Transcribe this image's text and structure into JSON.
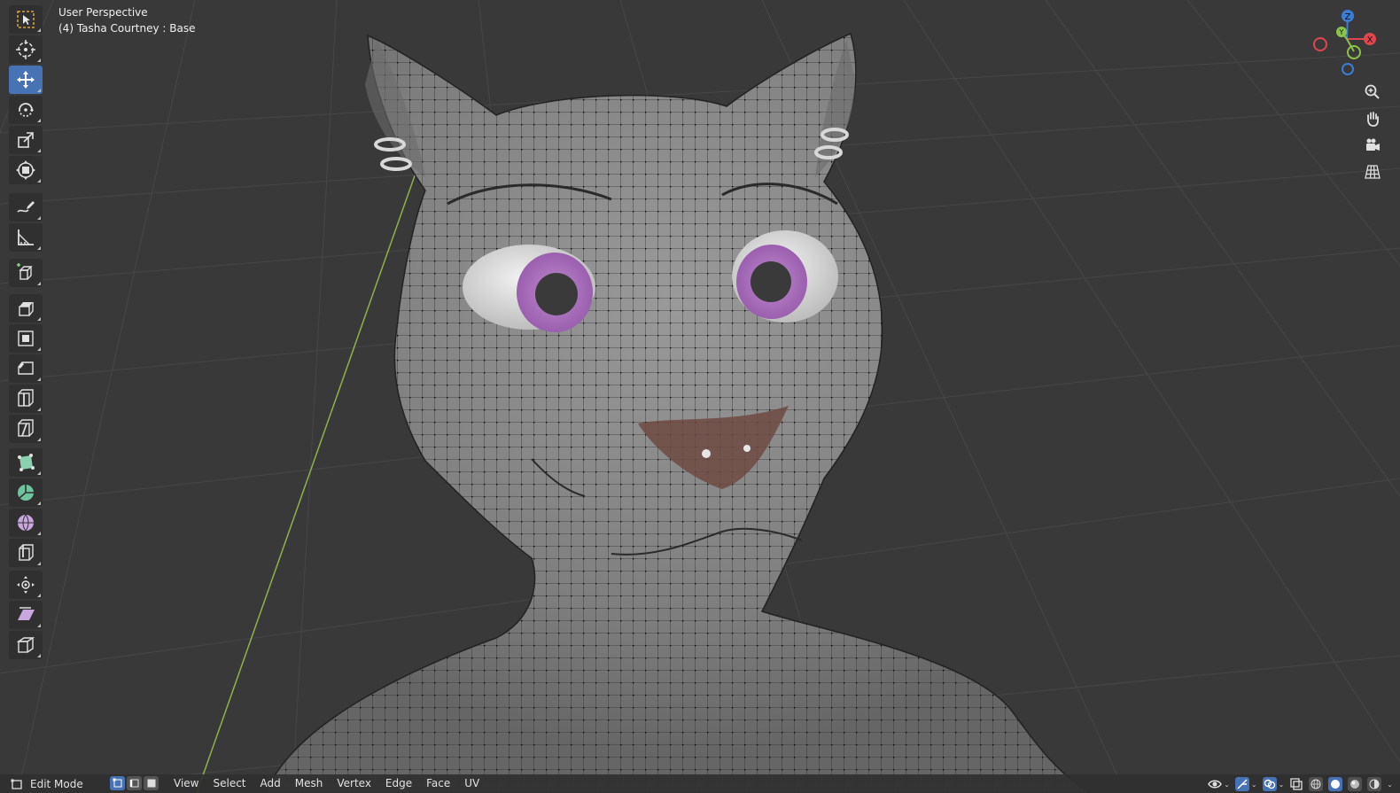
{
  "viewport": {
    "view_name": "User Perspective",
    "object_info": "(4) Tasha Courtney : Base"
  },
  "toolbar": {
    "tools": [
      {
        "name": "select-box-tool",
        "icon": "select-box-icon",
        "active": false
      },
      {
        "name": "cursor-tool",
        "icon": "cursor-icon",
        "active": false
      },
      {
        "name": "move-tool",
        "icon": "move-icon",
        "active": true
      },
      {
        "name": "rotate-tool",
        "icon": "rotate-icon",
        "active": false
      },
      {
        "name": "scale-tool",
        "icon": "scale-icon",
        "active": false
      },
      {
        "name": "transform-tool",
        "icon": "transform-icon",
        "active": false
      },
      {
        "name": "annotate-tool",
        "icon": "annotate-icon",
        "active": false
      },
      {
        "name": "measure-tool",
        "icon": "measure-icon",
        "active": false
      },
      {
        "name": "add-cube-tool",
        "icon": "add-cube-icon",
        "active": false
      },
      {
        "name": "extrude-tool",
        "icon": "extrude-icon",
        "active": false
      },
      {
        "name": "inset-faces-tool",
        "icon": "inset-icon",
        "active": false
      },
      {
        "name": "bevel-tool",
        "icon": "bevel-icon",
        "active": false
      },
      {
        "name": "loop-cut-tool",
        "icon": "loop-cut-icon",
        "active": false
      },
      {
        "name": "knife-tool",
        "icon": "knife-icon",
        "active": false
      },
      {
        "name": "poly-build-tool",
        "icon": "poly-build-icon",
        "active": false
      },
      {
        "name": "spin-tool",
        "icon": "spin-icon",
        "active": false
      },
      {
        "name": "smooth-tool",
        "icon": "smooth-icon",
        "active": false
      },
      {
        "name": "edge-slide-tool",
        "icon": "edge-slide-icon",
        "active": false
      },
      {
        "name": "shrink-fatten-tool",
        "icon": "shrink-fatten-icon",
        "active": false
      },
      {
        "name": "shear-tool",
        "icon": "shear-icon",
        "active": false
      },
      {
        "name": "rip-region-tool",
        "icon": "rip-icon",
        "active": false
      }
    ]
  },
  "gizmo": {
    "z_label": "Z",
    "y_label": "Y",
    "x_label": "X",
    "colors": {
      "x": "#e1464f",
      "y": "#8bc34a",
      "z": "#3c7ed6"
    }
  },
  "header": {
    "mode_label": "Edit Mode",
    "menus": [
      "View",
      "Select",
      "Add",
      "Mesh",
      "Vertex",
      "Edge",
      "Face",
      "UV"
    ]
  },
  "colors": {
    "background": "#393939",
    "grid_line": "#474747",
    "accent": "#4772b3",
    "mesh_surface": "#8a8a8a",
    "iris": "#a36bb6",
    "green_axis": "#8fb24a"
  }
}
